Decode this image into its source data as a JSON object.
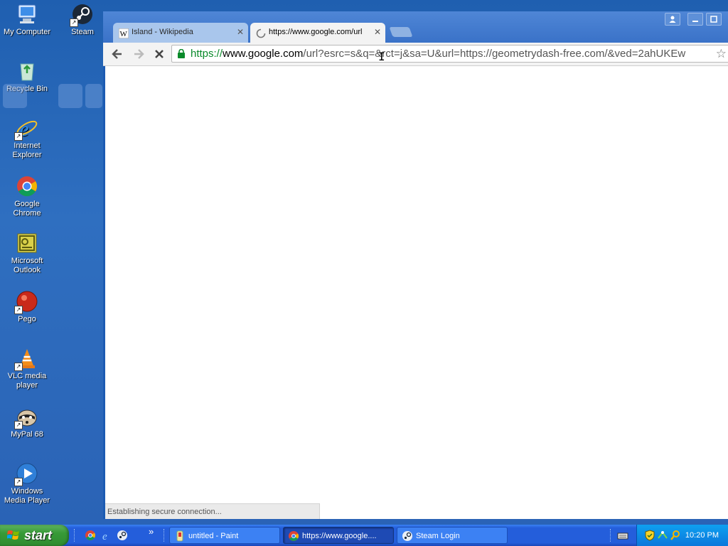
{
  "desktop": {
    "icons": [
      {
        "label": "My Computer"
      },
      {
        "label": "Steam"
      },
      {
        "label": "Recycle Bin"
      },
      {
        "label": "Internet Explorer"
      },
      {
        "label": "Google Chrome"
      },
      {
        "label": "Microsoft Outlook"
      },
      {
        "label": "Pego"
      },
      {
        "label": "VLC media player"
      },
      {
        "label": "MyPal 68"
      },
      {
        "label": "Windows Media Player"
      }
    ]
  },
  "browser": {
    "tabs": [
      {
        "title": "Island - Wikipedia",
        "favicon": "W",
        "active": false
      },
      {
        "title": "https://www.google.com/url",
        "favicon": "loading-spinner-icon",
        "active": true
      }
    ],
    "tab_close_glyph": "✕",
    "url": {
      "scheme": "https://",
      "host": "www.google.com",
      "rest": "/url?esrc=s&q=&rct=j&sa=U&url=https://geometrydash-free.com/&ved=2ahUKEw"
    },
    "status_text": "Establishing secure connection...",
    "nav_glyphs": {
      "back": "🡐",
      "forward": "🡒",
      "stop": "✕",
      "star": "☆"
    }
  },
  "taskbar": {
    "start_label": "start",
    "quicklaunch_more": "»",
    "tasks": [
      {
        "label": "untitled - Paint",
        "icon": "paint-icon",
        "active": false
      },
      {
        "label": "https://www.google....",
        "icon": "chrome-icon",
        "active": true
      },
      {
        "label": "Steam Login",
        "icon": "steam-icon",
        "active": false
      }
    ],
    "clock": "10:20 PM"
  },
  "colors": {
    "desktop": "#2a62b5",
    "taskbar": "#245edb",
    "start_green": "#379a37",
    "secure_green": "#0a8a2a"
  }
}
